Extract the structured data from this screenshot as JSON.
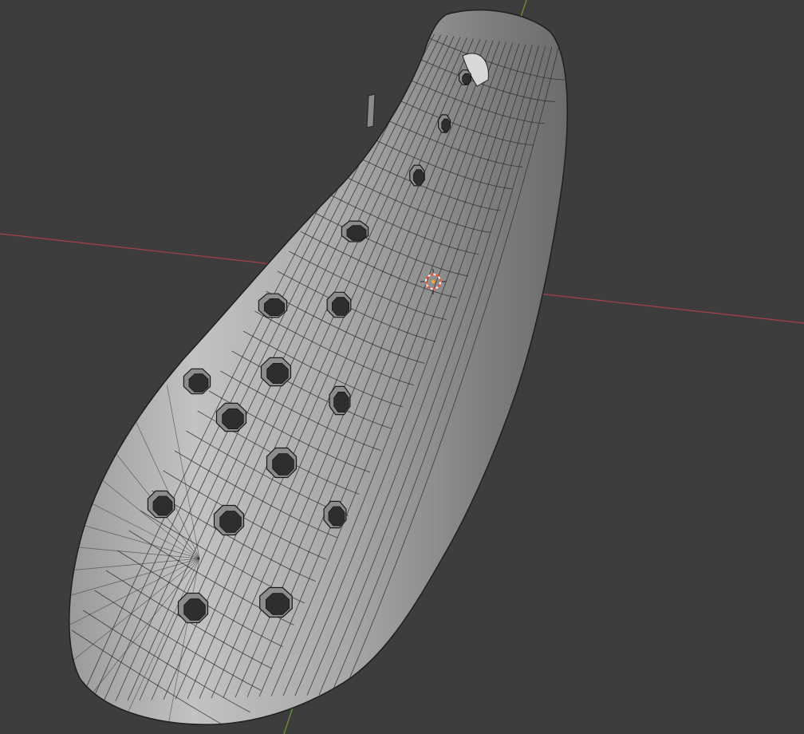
{
  "app": "3D viewport",
  "viewport": {
    "background_color": "#3d3d3d",
    "x_axis_color": "#a8414a",
    "y_axis_color": "#6f9a32",
    "mesh_color": "#b4b4b4",
    "wire_color": "#2a2a2a",
    "hole_count": 18
  },
  "cursor_3d": {
    "icon": "3d-cursor-icon",
    "colors": [
      "#ff4a2a",
      "#ffffff"
    ]
  }
}
